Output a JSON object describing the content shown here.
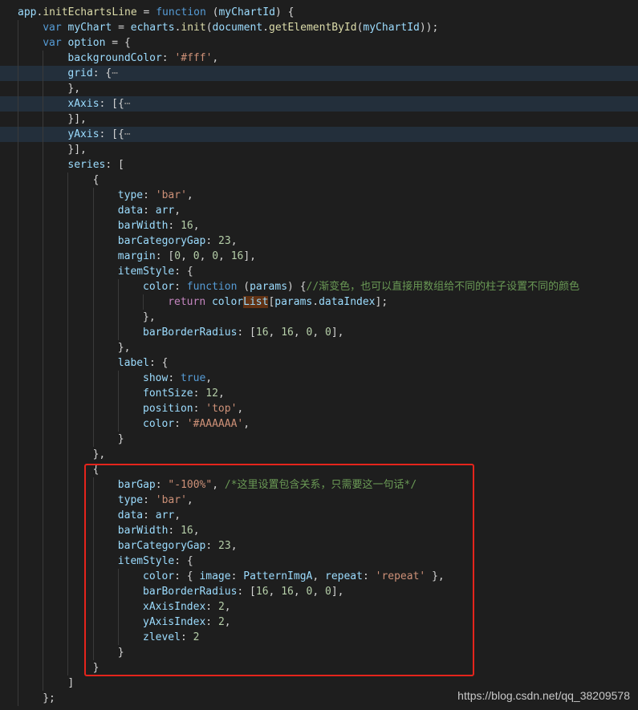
{
  "editor": {
    "background": "#1e1e1e",
    "fold_marker": "⋯",
    "lines": [
      {
        "indent": 0,
        "tokens": [
          [
            "var",
            "app"
          ],
          [
            "punc",
            "."
          ],
          [
            "fn",
            "initEchartsLine"
          ],
          [
            "punc",
            " = "
          ],
          [
            "kw",
            "function"
          ],
          [
            "punc",
            " ("
          ],
          [
            "var",
            "myChartId"
          ],
          [
            "punc",
            ") {"
          ]
        ]
      },
      {
        "indent": 1,
        "tokens": [
          [
            "kw",
            "var"
          ],
          [
            "punc",
            " "
          ],
          [
            "var",
            "myChart"
          ],
          [
            "punc",
            " = "
          ],
          [
            "var",
            "echarts"
          ],
          [
            "punc",
            "."
          ],
          [
            "fn",
            "init"
          ],
          [
            "punc",
            "("
          ],
          [
            "var",
            "document"
          ],
          [
            "punc",
            "."
          ],
          [
            "fn",
            "getElementById"
          ],
          [
            "punc",
            "("
          ],
          [
            "var",
            "myChartId"
          ],
          [
            "punc",
            "));"
          ]
        ]
      },
      {
        "indent": 1,
        "tokens": [
          [
            "kw",
            "var"
          ],
          [
            "punc",
            " "
          ],
          [
            "var",
            "option"
          ],
          [
            "punc",
            " = {"
          ]
        ]
      },
      {
        "indent": 2,
        "tokens": [
          [
            "var",
            "backgroundColor"
          ],
          [
            "punc",
            ": "
          ],
          [
            "str",
            "'#fff'"
          ],
          [
            "punc",
            ","
          ]
        ]
      },
      {
        "indent": 2,
        "folded": true,
        "tokens": [
          [
            "var",
            "grid"
          ],
          [
            "punc",
            ": {"
          ],
          [
            "fold",
            "⋯"
          ]
        ]
      },
      {
        "indent": 2,
        "tokens": [
          [
            "punc",
            "},"
          ]
        ]
      },
      {
        "indent": 2,
        "folded": true,
        "tokens": [
          [
            "var",
            "xAxis"
          ],
          [
            "punc",
            ": [{"
          ],
          [
            "fold",
            "⋯"
          ]
        ]
      },
      {
        "indent": 2,
        "tokens": [
          [
            "punc",
            "}],"
          ]
        ]
      },
      {
        "indent": 2,
        "folded": true,
        "tokens": [
          [
            "var",
            "yAxis"
          ],
          [
            "punc",
            ": [{"
          ],
          [
            "fold",
            "⋯"
          ]
        ]
      },
      {
        "indent": 2,
        "tokens": [
          [
            "punc",
            "}],"
          ]
        ]
      },
      {
        "indent": 2,
        "tokens": [
          [
            "var",
            "series"
          ],
          [
            "punc",
            ": ["
          ]
        ]
      },
      {
        "indent": 3,
        "tokens": [
          [
            "punc",
            "{"
          ]
        ]
      },
      {
        "indent": 4,
        "tokens": [
          [
            "var",
            "type"
          ],
          [
            "punc",
            ": "
          ],
          [
            "str",
            "'bar'"
          ],
          [
            "punc",
            ","
          ]
        ]
      },
      {
        "indent": 4,
        "tokens": [
          [
            "var",
            "data"
          ],
          [
            "punc",
            ": "
          ],
          [
            "var",
            "arr"
          ],
          [
            "punc",
            ","
          ]
        ]
      },
      {
        "indent": 4,
        "tokens": [
          [
            "var",
            "barWidth"
          ],
          [
            "punc",
            ": "
          ],
          [
            "num",
            "16"
          ],
          [
            "punc",
            ","
          ]
        ]
      },
      {
        "indent": 4,
        "tokens": [
          [
            "var",
            "barCategoryGap"
          ],
          [
            "punc",
            ": "
          ],
          [
            "num",
            "23"
          ],
          [
            "punc",
            ","
          ]
        ]
      },
      {
        "indent": 4,
        "tokens": [
          [
            "var",
            "margin"
          ],
          [
            "punc",
            ": ["
          ],
          [
            "num",
            "0"
          ],
          [
            "punc",
            ", "
          ],
          [
            "num",
            "0"
          ],
          [
            "punc",
            ", "
          ],
          [
            "num",
            "0"
          ],
          [
            "punc",
            ", "
          ],
          [
            "num",
            "16"
          ],
          [
            "punc",
            "],"
          ]
        ]
      },
      {
        "indent": 4,
        "tokens": [
          [
            "var",
            "itemStyle"
          ],
          [
            "punc",
            ": {"
          ]
        ]
      },
      {
        "indent": 5,
        "tokens": [
          [
            "var",
            "color"
          ],
          [
            "punc",
            ": "
          ],
          [
            "kw",
            "function"
          ],
          [
            "punc",
            " ("
          ],
          [
            "var",
            "params"
          ],
          [
            "punc",
            ") {"
          ],
          [
            "com",
            "//渐变色，也可以直接用数组给不同的柱子设置不同的颜色"
          ]
        ]
      },
      {
        "indent": 6,
        "tokens": [
          [
            "ctrl",
            "return"
          ],
          [
            "punc",
            " "
          ],
          [
            "var",
            "color"
          ],
          [
            "hl",
            "List"
          ],
          [
            "punc",
            "["
          ],
          [
            "var",
            "params"
          ],
          [
            "punc",
            "."
          ],
          [
            "var",
            "dataIndex"
          ],
          [
            "punc",
            "];"
          ]
        ]
      },
      {
        "indent": 5,
        "tokens": [
          [
            "punc",
            "},"
          ]
        ]
      },
      {
        "indent": 5,
        "tokens": [
          [
            "var",
            "barBorderRadius"
          ],
          [
            "punc",
            ": ["
          ],
          [
            "num",
            "16"
          ],
          [
            "punc",
            ", "
          ],
          [
            "num",
            "16"
          ],
          [
            "punc",
            ", "
          ],
          [
            "num",
            "0"
          ],
          [
            "punc",
            ", "
          ],
          [
            "num",
            "0"
          ],
          [
            "punc",
            "],"
          ]
        ]
      },
      {
        "indent": 4,
        "tokens": [
          [
            "punc",
            "},"
          ]
        ]
      },
      {
        "indent": 4,
        "tokens": [
          [
            "var",
            "label"
          ],
          [
            "punc",
            ": {"
          ]
        ]
      },
      {
        "indent": 5,
        "tokens": [
          [
            "var",
            "show"
          ],
          [
            "punc",
            ": "
          ],
          [
            "kw",
            "true"
          ],
          [
            "punc",
            ","
          ]
        ]
      },
      {
        "indent": 5,
        "tokens": [
          [
            "var",
            "fontSize"
          ],
          [
            "punc",
            ": "
          ],
          [
            "num",
            "12"
          ],
          [
            "punc",
            ","
          ]
        ]
      },
      {
        "indent": 5,
        "tokens": [
          [
            "var",
            "position"
          ],
          [
            "punc",
            ": "
          ],
          [
            "str",
            "'top'"
          ],
          [
            "punc",
            ","
          ]
        ]
      },
      {
        "indent": 5,
        "tokens": [
          [
            "var",
            "color"
          ],
          [
            "punc",
            ": "
          ],
          [
            "str",
            "'#AAAAAA'"
          ],
          [
            "punc",
            ","
          ]
        ]
      },
      {
        "indent": 4,
        "tokens": [
          [
            "punc",
            "}"
          ]
        ]
      },
      {
        "indent": 3,
        "tokens": [
          [
            "punc",
            "},"
          ]
        ]
      },
      {
        "indent": 3,
        "tokens": [
          [
            "punc",
            "{"
          ]
        ]
      },
      {
        "indent": 4,
        "tokens": [
          [
            "var",
            "barGap"
          ],
          [
            "punc",
            ": "
          ],
          [
            "str",
            "\"-100%\""
          ],
          [
            "punc",
            ", "
          ],
          [
            "com",
            "/*这里设置包含关系，只需要这一句话*/"
          ]
        ]
      },
      {
        "indent": 4,
        "tokens": [
          [
            "var",
            "type"
          ],
          [
            "punc",
            ": "
          ],
          [
            "str",
            "'bar'"
          ],
          [
            "punc",
            ","
          ]
        ]
      },
      {
        "indent": 4,
        "tokens": [
          [
            "var",
            "data"
          ],
          [
            "punc",
            ": "
          ],
          [
            "var",
            "arr"
          ],
          [
            "punc",
            ","
          ]
        ]
      },
      {
        "indent": 4,
        "tokens": [
          [
            "var",
            "barWidth"
          ],
          [
            "punc",
            ": "
          ],
          [
            "num",
            "16"
          ],
          [
            "punc",
            ","
          ]
        ]
      },
      {
        "indent": 4,
        "tokens": [
          [
            "var",
            "barCategoryGap"
          ],
          [
            "punc",
            ": "
          ],
          [
            "num",
            "23"
          ],
          [
            "punc",
            ","
          ]
        ]
      },
      {
        "indent": 4,
        "tokens": [
          [
            "var",
            "itemStyle"
          ],
          [
            "punc",
            ": {"
          ]
        ]
      },
      {
        "indent": 5,
        "tokens": [
          [
            "var",
            "color"
          ],
          [
            "punc",
            ": { "
          ],
          [
            "var",
            "image"
          ],
          [
            "punc",
            ": "
          ],
          [
            "var",
            "PatternImgA"
          ],
          [
            "punc",
            ", "
          ],
          [
            "var",
            "repeat"
          ],
          [
            "punc",
            ": "
          ],
          [
            "str",
            "'repeat'"
          ],
          [
            "punc",
            " },"
          ]
        ]
      },
      {
        "indent": 5,
        "tokens": [
          [
            "var",
            "barBorderRadius"
          ],
          [
            "punc",
            ": ["
          ],
          [
            "num",
            "16"
          ],
          [
            "punc",
            ", "
          ],
          [
            "num",
            "16"
          ],
          [
            "punc",
            ", "
          ],
          [
            "num",
            "0"
          ],
          [
            "punc",
            ", "
          ],
          [
            "num",
            "0"
          ],
          [
            "punc",
            "],"
          ]
        ]
      },
      {
        "indent": 5,
        "tokens": [
          [
            "var",
            "xAxisIndex"
          ],
          [
            "punc",
            ": "
          ],
          [
            "num",
            "2"
          ],
          [
            "punc",
            ","
          ]
        ]
      },
      {
        "indent": 5,
        "tokens": [
          [
            "var",
            "yAxisIndex"
          ],
          [
            "punc",
            ": "
          ],
          [
            "num",
            "2"
          ],
          [
            "punc",
            ","
          ]
        ]
      },
      {
        "indent": 5,
        "tokens": [
          [
            "var",
            "zlevel"
          ],
          [
            "punc",
            ": "
          ],
          [
            "num",
            "2"
          ]
        ]
      },
      {
        "indent": 4,
        "tokens": [
          [
            "punc",
            "}"
          ]
        ]
      },
      {
        "indent": 3,
        "tokens": [
          [
            "punc",
            "}"
          ]
        ]
      },
      {
        "indent": 2,
        "tokens": [
          [
            "punc",
            "]"
          ]
        ]
      },
      {
        "indent": 1,
        "tokens": [
          [
            "punc",
            "};"
          ]
        ]
      }
    ]
  },
  "highlight_box_color": "#e5241c",
  "watermark": "https://blog.csdn.net/qq_38209578"
}
